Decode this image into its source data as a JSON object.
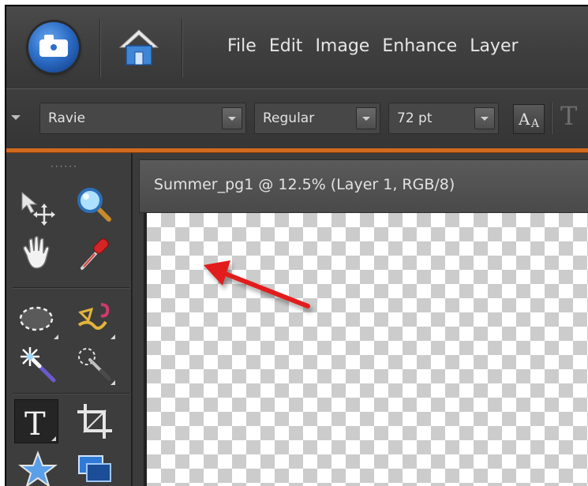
{
  "menubar": {
    "items": [
      "File",
      "Edit",
      "Image",
      "Enhance",
      "Layer"
    ]
  },
  "options": {
    "font_family": "Ravie",
    "font_style": "Regular",
    "font_size": "72 pt"
  },
  "document": {
    "title": "Summer_pg1 @ 12.5% (Layer 1, RGB/8)"
  },
  "toolbox": {
    "tools": [
      "move-tool",
      "zoom-tool",
      "hand-tool",
      "eyedropper-tool",
      "elliptical-marquee-tool",
      "lasso-tool",
      "magic-wand-tool",
      "quick-selection-tool",
      "type-tool",
      "crop-tool",
      "shape-tool",
      "cookie-cutter-tool"
    ],
    "selected": "type-tool"
  },
  "colors": {
    "accent_orange": "#d2691e",
    "annotation_arrow": "#e21b1b"
  }
}
